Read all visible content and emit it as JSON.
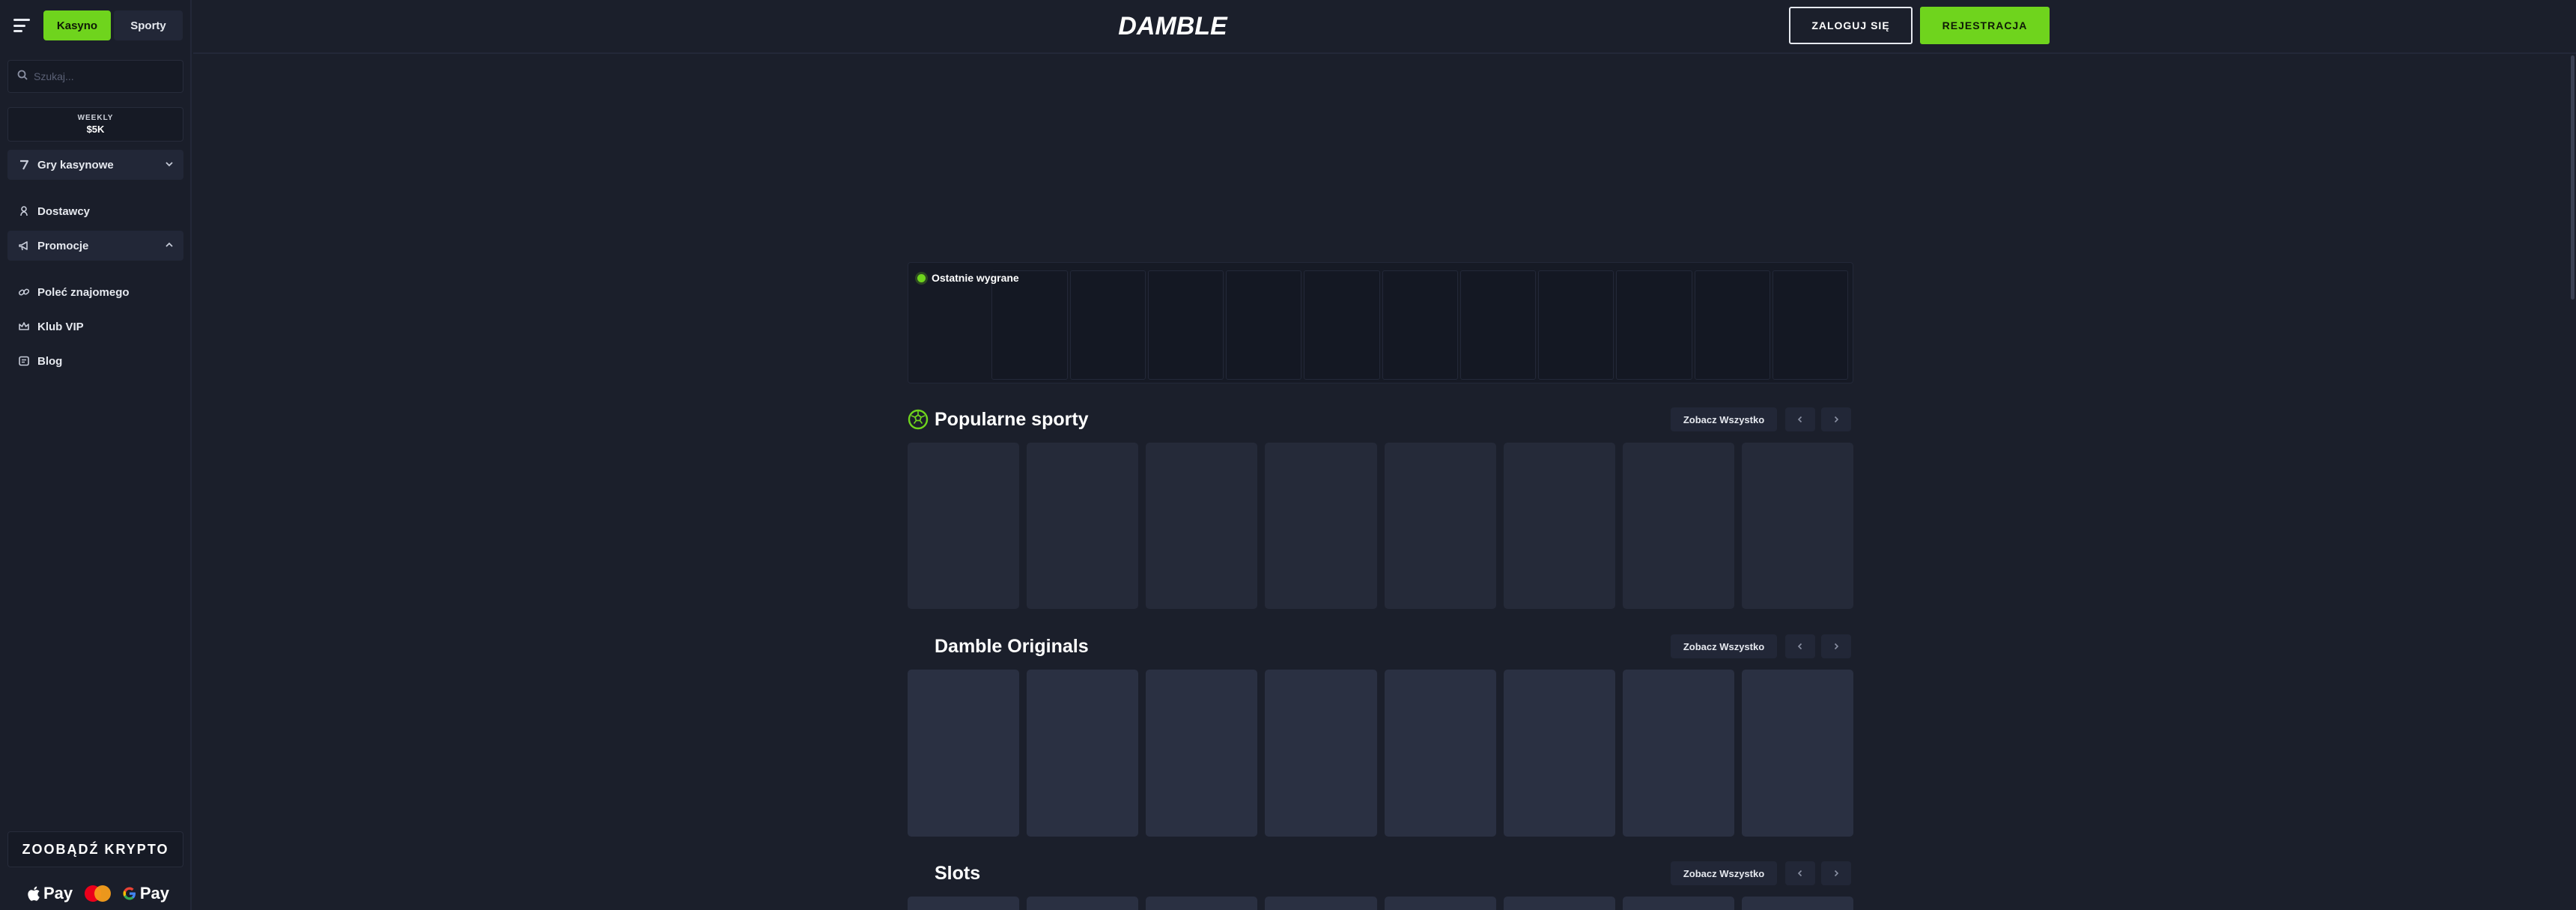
{
  "sidebar": {
    "tabs": [
      {
        "label": "Kasyno",
        "active": true
      },
      {
        "label": "Sporty",
        "active": false
      }
    ],
    "search": {
      "placeholder": "Szukaj..."
    },
    "weekly_banner": {
      "line1": "WEEKLY",
      "line2": "$5K"
    },
    "nav": [
      {
        "label": "Gry kasynowe",
        "icon": "slot-seven-icon",
        "expanded": false
      },
      {
        "label": "Dostawcy",
        "icon": "provider-icon"
      },
      {
        "label": "Promocje",
        "icon": "megaphone-icon",
        "expanded": true
      },
      {
        "label": "Poleć znajomego",
        "icon": "link-icon"
      },
      {
        "label": "Klub VIP",
        "icon": "crown-icon"
      },
      {
        "label": "Blog",
        "icon": "blog-icon"
      }
    ],
    "crypto_button": "ZOOBĄDŹ KRYPTO",
    "payments": [
      {
        "label": "Pay",
        "brand": "apple-pay"
      },
      {
        "label": "",
        "brand": "mastercard"
      },
      {
        "label": "Pay",
        "brand": "google-pay"
      }
    ]
  },
  "header": {
    "logo": "DAMBLE",
    "login": "ZALOGUJ SIĘ",
    "register": "REJESTRACJA"
  },
  "recent_wins": {
    "title": "Ostatnie wygrane",
    "cell_count": 12
  },
  "sections": [
    {
      "title": "Popularne sporty",
      "see_all": "Zobacz Wszystko",
      "icon": "football-icon",
      "card_count": 8
    },
    {
      "title": "Damble Originals",
      "see_all": "Zobacz Wszystko",
      "card_count": 8
    },
    {
      "title": "Slots",
      "see_all": "Zobacz Wszystko",
      "card_count": 8
    }
  ],
  "colors": {
    "accent": "#6fd41d",
    "background": "#1b1f2b",
    "sidebar": "#1a1e2a",
    "card": "#252a39"
  }
}
